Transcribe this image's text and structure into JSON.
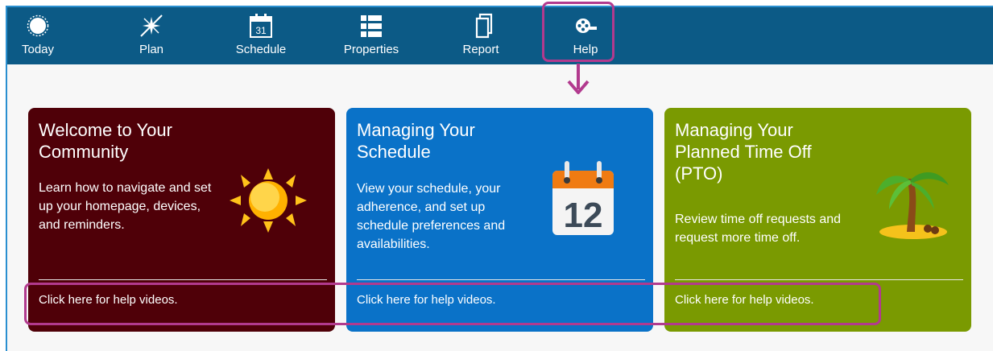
{
  "nav": {
    "items": [
      {
        "label": "Today",
        "icon": "sun-icon"
      },
      {
        "label": "Plan",
        "icon": "compass-star-icon"
      },
      {
        "label": "Schedule",
        "icon": "calendar-icon"
      },
      {
        "label": "Properties",
        "icon": "list-icon"
      },
      {
        "label": "Report",
        "icon": "document-copy-icon"
      },
      {
        "label": "Help",
        "icon": "film-reel-icon"
      }
    ],
    "calendar_day": "31"
  },
  "cards": [
    {
      "title": "Welcome to Your Community",
      "description": "Learn how to navigate and set up your homepage, devices, and reminders.",
      "link": "Click here for help videos.",
      "illustration": "sun-illustration",
      "color": "#4f0008"
    },
    {
      "title": "Managing Your Schedule",
      "description": "View your schedule, your adherence, and set up schedule preferences and availabilities.",
      "link": "Click here for help videos.",
      "illustration": "calendar-illustration",
      "calendar_number": "12",
      "color": "#0a72c8"
    },
    {
      "title": "Managing Your Planned Time Off (PTO)",
      "description": "Review time off requests and request more time off.",
      "link": "Click here for help videos.",
      "illustration": "palm-tree-illustration",
      "color": "#7a9a01"
    }
  ],
  "colors": {
    "navbar": "#0c5a86",
    "highlight": "#b23a8e",
    "page_border": "#2a8fd0"
  }
}
